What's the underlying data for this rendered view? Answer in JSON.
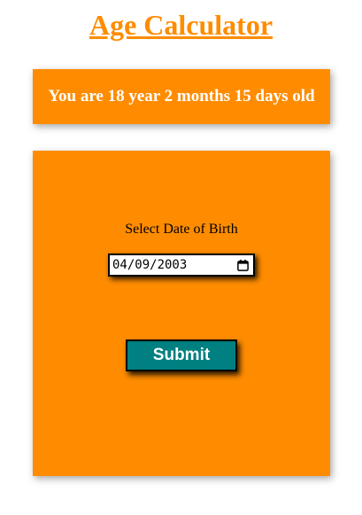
{
  "title": "Age Calculator",
  "result": {
    "text": "You are 18 year 2 months 15 days old"
  },
  "form": {
    "label": "Select Date of Birth",
    "date_value": "04/09/2003",
    "calendar_icon": "calendar-icon",
    "submit_label": "Submit"
  },
  "colors": {
    "accent": "#ff8c00",
    "button": "#008080",
    "text_light": "#ffffff"
  }
}
